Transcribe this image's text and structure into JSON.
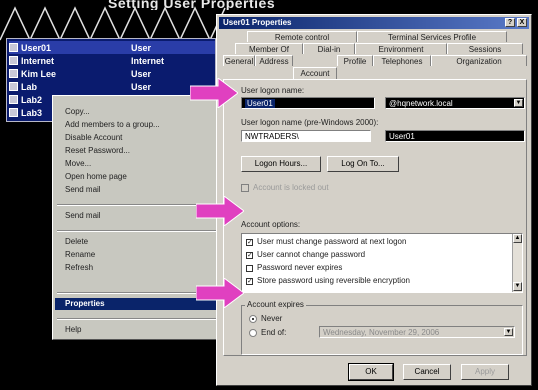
{
  "background": {
    "title": "Setting User Properties"
  },
  "users": [
    {
      "name": "User01",
      "type": "User",
      "selected": true
    },
    {
      "name": "Internet",
      "type": "Internet",
      "selected": false
    },
    {
      "name": "Kim Lee",
      "type": "User",
      "selected": false
    },
    {
      "name": "Lab",
      "type": "User",
      "selected": false
    },
    {
      "name": "Lab2",
      "type": "User",
      "selected": false
    },
    {
      "name": "Lab3",
      "type": "User",
      "selected": false
    }
  ],
  "context_menu": {
    "items": [
      "Copy...",
      "Add members to a group...",
      "Disable Account",
      "Reset Password...",
      "Move...",
      "Open home page",
      "Send mail"
    ],
    "send_to": "Send mail",
    "items2": [
      "Delete",
      "Rename",
      "Refresh"
    ],
    "properties": "Properties",
    "help": "Help"
  },
  "dialog": {
    "title": "User01 Properties",
    "title_buttons": [
      "?",
      "X"
    ],
    "tabs_row1": [
      "Remote control",
      "Terminal Services Profile"
    ],
    "tabs_row2": [
      "Member Of",
      "Dial-in",
      "Environment",
      "Sessions"
    ],
    "tabs_row3": [
      "General",
      "Address",
      "Account",
      "Profile",
      "Telephones",
      "Organization"
    ],
    "logon_label": "User logon name:",
    "logon_value": "User01",
    "domain_value": "@hqnetwork.local",
    "pre2000_label": "User logon name (pre-Windows 2000):",
    "pre2000_domain": "NWTRADERS\\",
    "pre2000_user": "User01",
    "logon_hours_btn": "Logon Hours...",
    "logon_to_btn": "Log On To...",
    "locked_label": "Account is locked out",
    "options_label": "Account options:",
    "options": [
      {
        "text": "User must change password at next logon",
        "checked": true
      },
      {
        "text": "User cannot change password",
        "checked": true
      },
      {
        "text": "Password never expires",
        "checked": false
      },
      {
        "text": "Store password using reversible encryption",
        "checked": true
      }
    ],
    "expires_label": "Account expires",
    "never_label": "Never",
    "endof_label": "End of:",
    "endof_date": "Wednesday, November 29, 2006",
    "ok": "OK",
    "cancel": "Cancel",
    "apply": "Apply"
  },
  "colors": {
    "selection": "#0a246a",
    "arrow": "#e040c0",
    "dialog_bg": "#d4d0c8"
  }
}
